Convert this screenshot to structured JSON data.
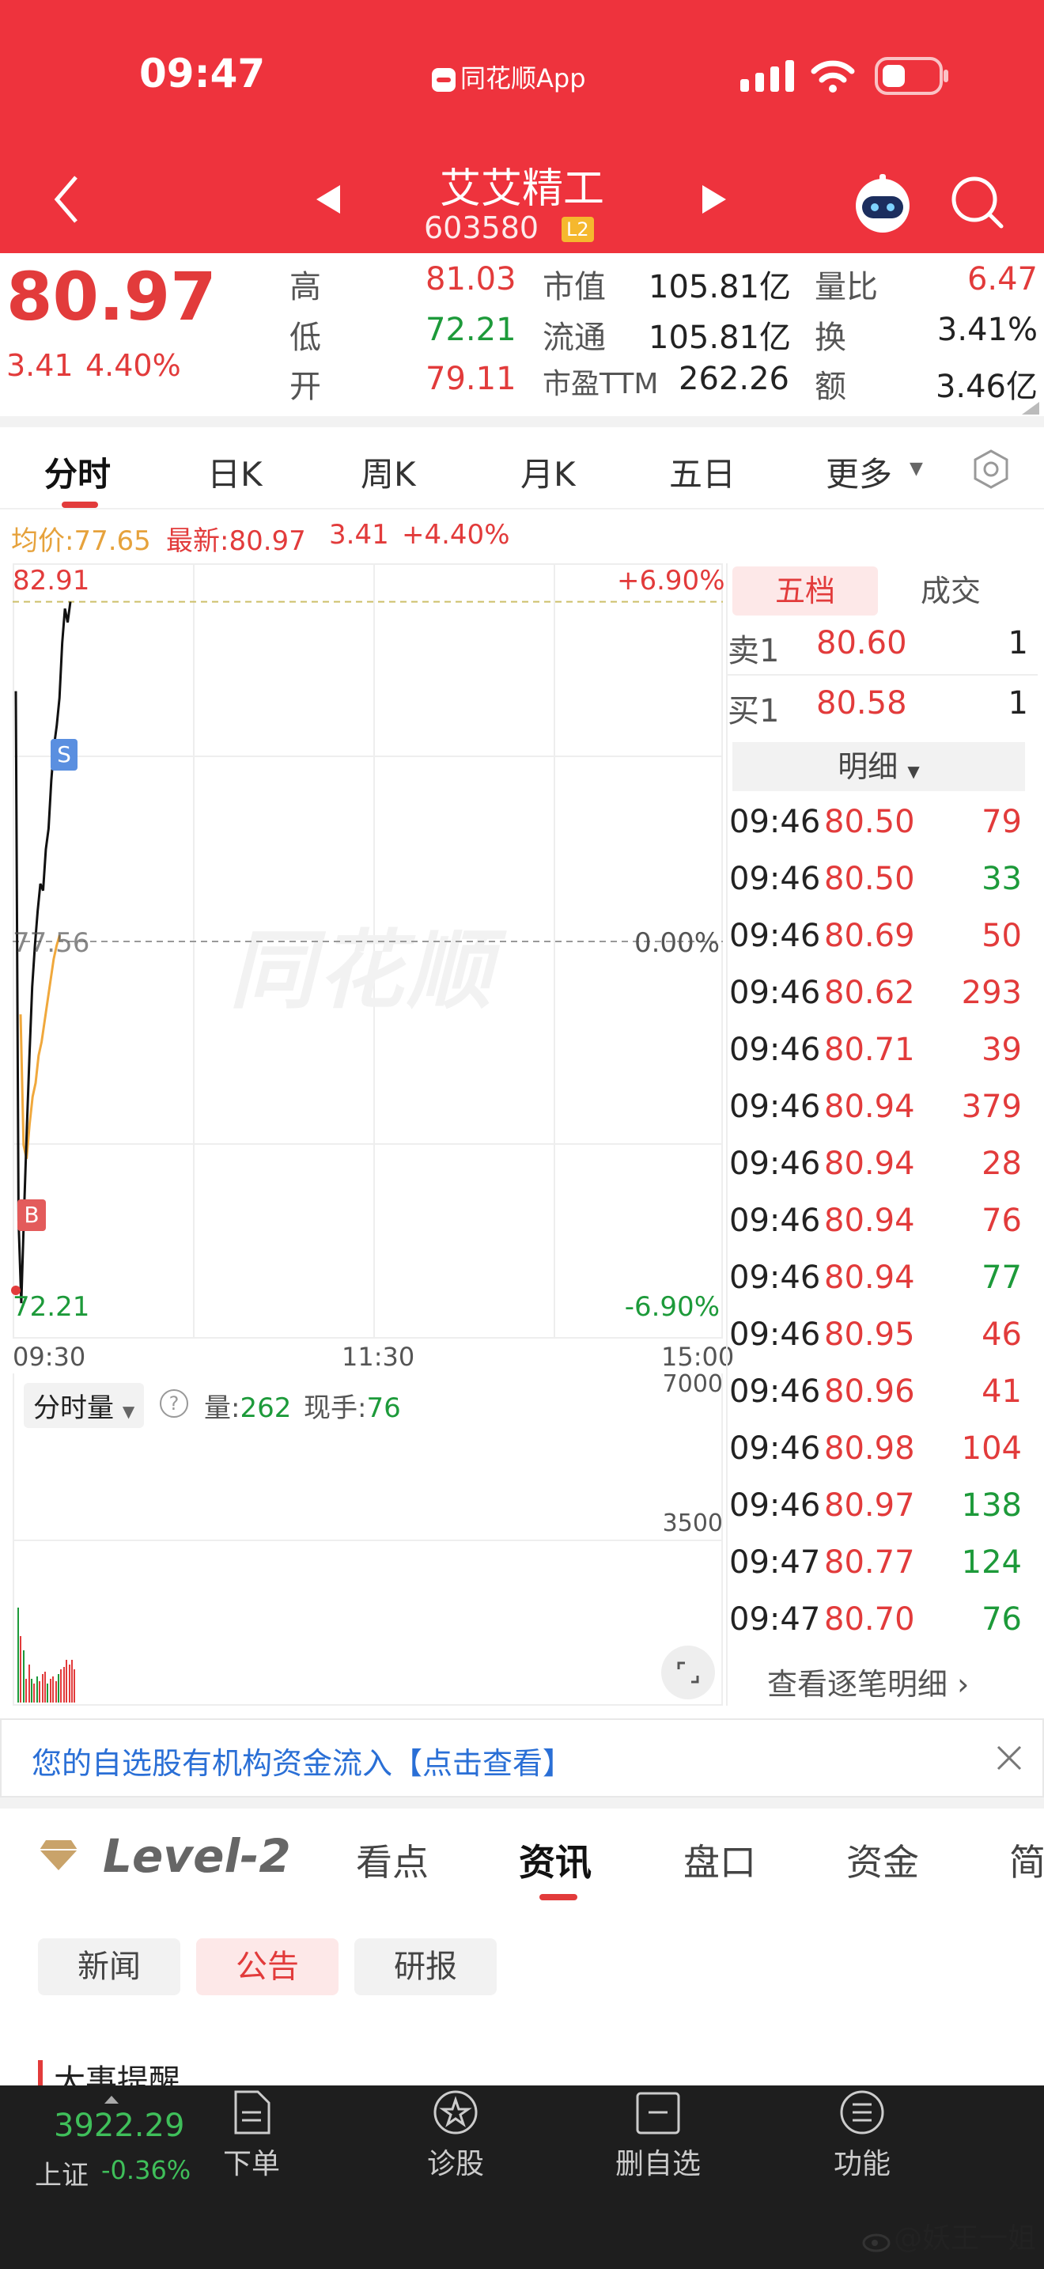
{
  "status_bar": {
    "time": "09:47",
    "center_app": "同花顺App"
  },
  "header": {
    "stock_name": "艾艾精工",
    "code": "603580",
    "level_badge": "L2"
  },
  "quote": {
    "price": "80.97",
    "change": "3.41",
    "change_pct": "4.40%",
    "high_label": "高",
    "high": "81.03",
    "low_label": "低",
    "low": "72.21",
    "open_label": "开",
    "open": "79.11",
    "mcap_label": "市值",
    "mcap": "105.81亿",
    "float_label": "流通",
    "float": "105.81亿",
    "pe_label": "市盈TTM",
    "pe": "262.26",
    "vr_label": "量比",
    "vr": "6.47",
    "turn_label": "换",
    "turn": "3.41%",
    "amt_label": "额",
    "amt": "3.46亿"
  },
  "chart_tabs": [
    "分时",
    "日K",
    "周K",
    "月K",
    "五日",
    "更多"
  ],
  "info_line": {
    "avg": "均价:77.65",
    "latest": "最新:80.97",
    "chg": "3.41",
    "pct": "+4.40%"
  },
  "chart_data": {
    "type": "line",
    "y_labels": {
      "top": "82.91",
      "mid": "77.56",
      "bottom": "72.21",
      "pct_top": "+6.90%",
      "pct_mid": "0.00%",
      "pct_bottom": "-6.90%"
    },
    "ylim": [
      72.21,
      82.91
    ],
    "x_labels": [
      "09:30",
      "11:30",
      "15:00"
    ],
    "markers": {
      "sell": "S",
      "buy": "B"
    },
    "series": [
      {
        "name": "最新",
        "values": [
          81.2,
          73.5,
          72.3,
          73.6,
          74.8,
          75.9,
          76.9,
          77.5,
          78.0,
          78.4,
          78.3,
          78.9,
          79.2,
          79.9,
          80.4,
          80.7,
          81.1,
          81.9,
          82.4,
          82.2,
          82.5
        ]
      },
      {
        "name": "均价",
        "values": [
          76.5,
          74.6,
          74.4,
          74.9,
          75.3,
          75.5,
          75.9,
          76.1,
          76.4,
          76.7,
          77.0,
          77.3,
          77.5,
          77.65
        ]
      }
    ],
    "volume": {
      "labels": {
        "top": "7000",
        "mid": "3500"
      },
      "ylim": [
        0,
        7000
      ],
      "bars": [
        {
          "v": 2000,
          "c": "g"
        },
        {
          "v": 1400,
          "c": "r"
        },
        {
          "v": 1100,
          "c": "g"
        },
        {
          "v": 500,
          "c": "r"
        },
        {
          "v": 800,
          "c": "r"
        },
        {
          "v": 500,
          "c": "g"
        },
        {
          "v": 400,
          "c": "r"
        },
        {
          "v": 550,
          "c": "g"
        },
        {
          "v": 450,
          "c": "r"
        },
        {
          "v": 600,
          "c": "r"
        },
        {
          "v": 650,
          "c": "r"
        },
        {
          "v": 400,
          "c": "g"
        },
        {
          "v": 500,
          "c": "r"
        },
        {
          "v": 550,
          "c": "r"
        },
        {
          "v": 450,
          "c": "r"
        },
        {
          "v": 600,
          "c": "g"
        },
        {
          "v": 700,
          "c": "r"
        },
        {
          "v": 750,
          "c": "r"
        },
        {
          "v": 900,
          "c": "r"
        },
        {
          "v": 800,
          "c": "r"
        },
        {
          "v": 900,
          "c": "r"
        },
        {
          "v": 700,
          "c": "r"
        }
      ]
    }
  },
  "volume_panel": {
    "label": "分时量",
    "qty_label": "量:",
    "qty": "262",
    "hand_label": "现手:",
    "hand": "76"
  },
  "orderbook": {
    "tab_active": "五档",
    "tab_other": "成交",
    "sell1": {
      "label": "卖1",
      "price": "80.60",
      "qty": "1"
    },
    "buy1": {
      "label": "买1",
      "price": "80.58",
      "qty": "1"
    },
    "detail_label": "明细",
    "trades": [
      {
        "t": "09:46",
        "p": "80.50",
        "q": "79",
        "c": "r"
      },
      {
        "t": "09:46",
        "p": "80.50",
        "q": "33",
        "c": "g"
      },
      {
        "t": "09:46",
        "p": "80.69",
        "q": "50",
        "c": "r"
      },
      {
        "t": "09:46",
        "p": "80.62",
        "q": "293",
        "c": "r"
      },
      {
        "t": "09:46",
        "p": "80.71",
        "q": "39",
        "c": "r"
      },
      {
        "t": "09:46",
        "p": "80.94",
        "q": "379",
        "c": "r"
      },
      {
        "t": "09:46",
        "p": "80.94",
        "q": "28",
        "c": "r"
      },
      {
        "t": "09:46",
        "p": "80.94",
        "q": "76",
        "c": "r"
      },
      {
        "t": "09:46",
        "p": "80.94",
        "q": "77",
        "c": "g"
      },
      {
        "t": "09:46",
        "p": "80.95",
        "q": "46",
        "c": "r"
      },
      {
        "t": "09:46",
        "p": "80.96",
        "q": "41",
        "c": "r"
      },
      {
        "t": "09:46",
        "p": "80.98",
        "q": "104",
        "c": "r"
      },
      {
        "t": "09:46",
        "p": "80.97",
        "q": "138",
        "c": "g"
      },
      {
        "t": "09:47",
        "p": "80.77",
        "q": "124",
        "c": "g"
      },
      {
        "t": "09:47",
        "p": "80.70",
        "q": "76",
        "c": "g"
      }
    ],
    "more_link": "查看逐笔明细"
  },
  "banner": {
    "text": "您的自选股有机构资金流入【点击查看】"
  },
  "info_tabs": {
    "level2": "Level-2",
    "tabs": [
      "看点",
      "资讯",
      "盘口",
      "资金",
      "简"
    ]
  },
  "sub_tabs": [
    "新闻",
    "公告",
    "研报"
  ],
  "section_title": "大事提醒",
  "bottom_nav": {
    "index_value": "3922.29",
    "index_name": "上证",
    "index_change": "-0.36%",
    "items": [
      {
        "label": "下单",
        "icon": "document-icon"
      },
      {
        "label": "诊股",
        "icon": "diagnose-icon"
      },
      {
        "label": "删自选",
        "icon": "remove-watchlist-icon"
      },
      {
        "label": "功能",
        "icon": "menu-icon"
      }
    ]
  },
  "watermark": "@妖王一姐",
  "chart_watermark": "同花顺"
}
